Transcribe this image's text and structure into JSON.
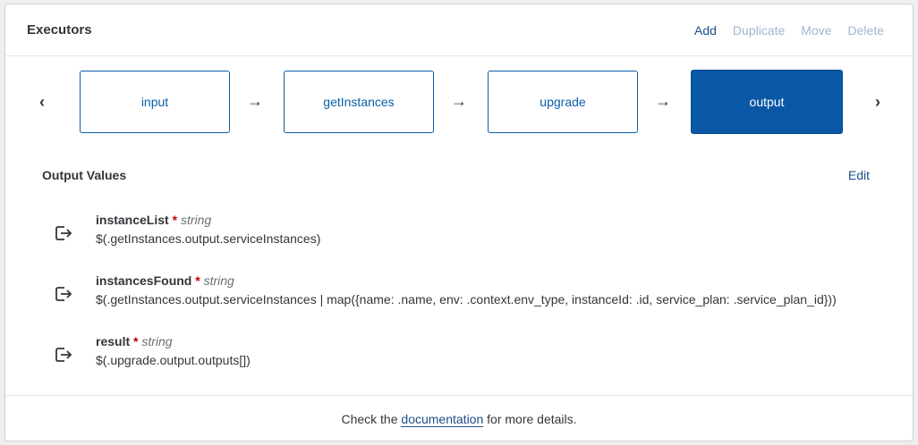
{
  "header": {
    "title": "Executors",
    "actions": [
      {
        "label": "Add",
        "enabled": true
      },
      {
        "label": "Duplicate",
        "enabled": false
      },
      {
        "label": "Move",
        "enabled": false
      },
      {
        "label": "Delete",
        "enabled": false
      }
    ]
  },
  "steps": {
    "prev_icon": "chevron-left",
    "next_icon": "chevron-right",
    "items": [
      {
        "label": "input",
        "active": false
      },
      {
        "label": "getInstances",
        "active": false
      },
      {
        "label": "upgrade",
        "active": false
      },
      {
        "label": "output",
        "active": true
      }
    ]
  },
  "output": {
    "title": "Output Values",
    "edit_label": "Edit",
    "items": [
      {
        "name": "instanceList",
        "required": "*",
        "type": "string",
        "expression": "$(.getInstances.output.serviceInstances)"
      },
      {
        "name": "instancesFound",
        "required": "*",
        "type": "string",
        "expression": "$(.getInstances.output.serviceInstances | map({name: .name, env: .context.env_type, instanceId: .id, service_plan: .service_plan_id}))"
      },
      {
        "name": "result",
        "required": "*",
        "type": "string",
        "expression": "$(.upgrade.output.outputs[])"
      }
    ]
  },
  "footer": {
    "prefix": "Check the",
    "link": "documentation",
    "suffix": "for more details."
  },
  "colors": {
    "accent": "#0a57a5",
    "link": "#1d4e89",
    "required": "#bb0000"
  }
}
